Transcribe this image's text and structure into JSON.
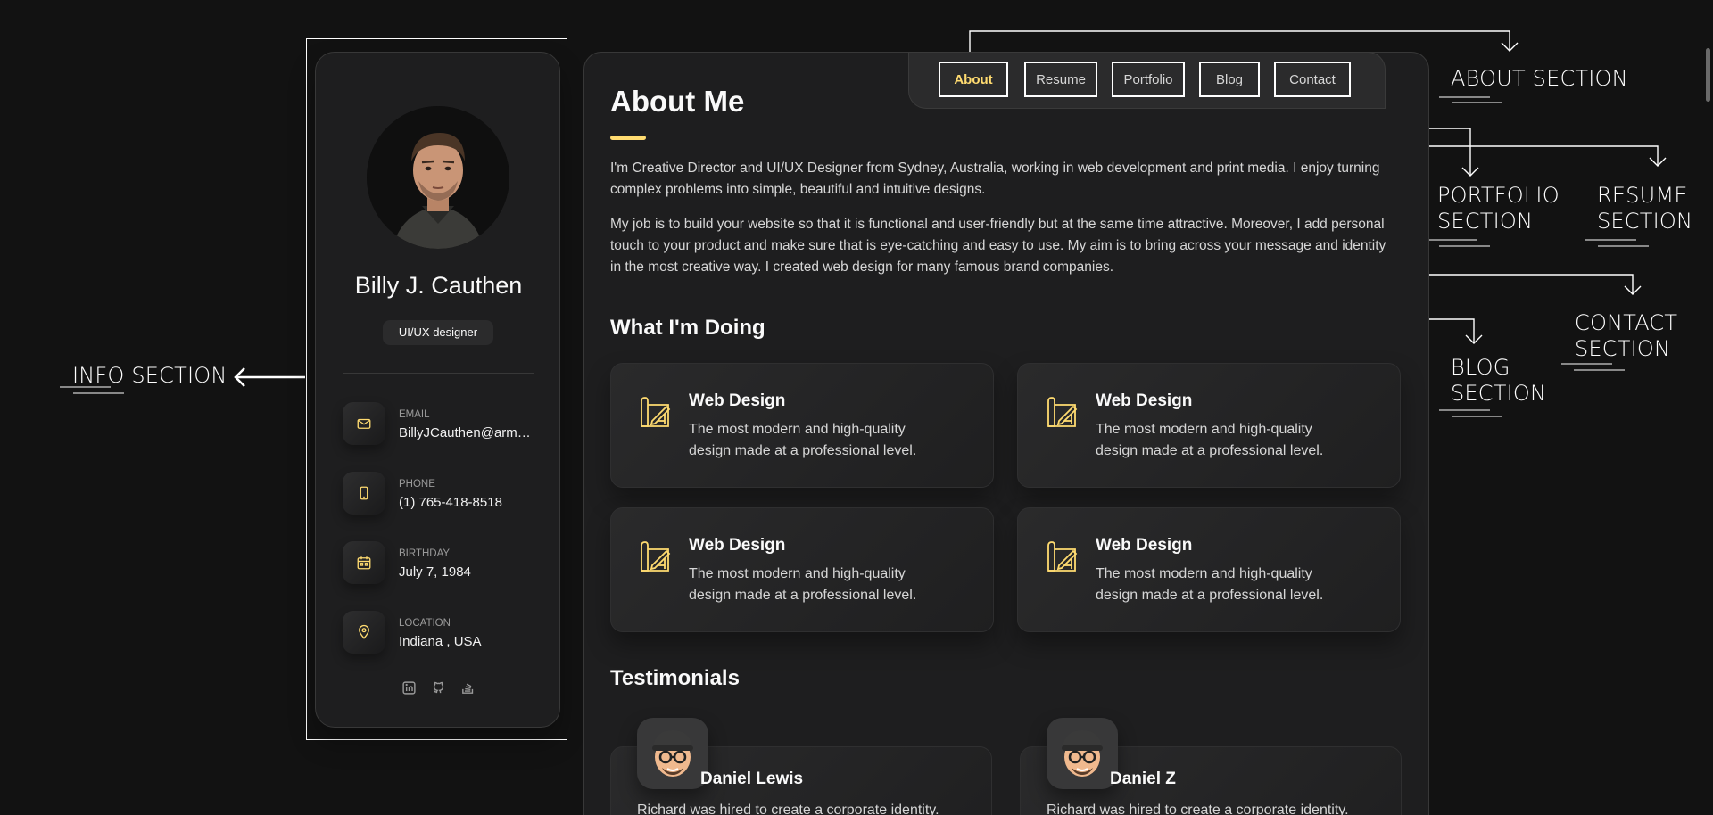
{
  "profile": {
    "name": "Billy J. Cauthen",
    "title": "UI/UX designer"
  },
  "contacts": [
    {
      "label": "EMAIL",
      "value": "BillyJCauthen@arm…",
      "icon": "mail-icon"
    },
    {
      "label": "PHONE",
      "value": "(1) 765-418-8518",
      "icon": "phone-icon"
    },
    {
      "label": "BIRTHDAY",
      "value": "July 7, 1984",
      "icon": "calendar-icon"
    },
    {
      "label": "LOCATION",
      "value": "Indiana , USA",
      "icon": "location-pin-icon"
    }
  ],
  "socials": [
    "linkedin-icon",
    "github-icon",
    "stackoverflow-icon"
  ],
  "nav": {
    "items": [
      "About",
      "Resume",
      "Portfolio",
      "Blog",
      "Contact"
    ],
    "active": "About"
  },
  "about": {
    "title": "About Me",
    "paragraph_1": "I'm Creative Director and UI/UX Designer from Sydney, Australia, working in web development and print media. I enjoy turning complex problems into simple, beautiful and intuitive designs.",
    "paragraph_2": "My job is to build your website so that it is functional and user-friendly but at the same time attractive. Moreover, I add personal touch to your product and make sure that is eye-catching and easy to use. My aim is to bring across your message and identity in the most creative way. I created web design for many famous brand companies."
  },
  "services": {
    "title": "What I'm Doing",
    "items": [
      {
        "title": "Web Design",
        "desc": "The most modern and high-quality design made at a professional level."
      },
      {
        "title": "Web Design",
        "desc": "The most modern and high-quality design made at a professional level."
      },
      {
        "title": "Web Design",
        "desc": "The most modern and high-quality design made at a professional level."
      },
      {
        "title": "Web Design",
        "desc": "The most modern and high-quality design made at a professional level."
      }
    ]
  },
  "testimonials": {
    "title": "Testimonials",
    "items": [
      {
        "name": "Daniel Lewis",
        "text": "Richard was hired to create a corporate identity."
      },
      {
        "name": "Daniel Z",
        "text": "Richard was hired to create a corporate identity."
      }
    ]
  },
  "annotations": {
    "info": "INFO SECTION",
    "about": "ABOUT SECTION",
    "portfolio": [
      "PORTFOLIO",
      "SECTION"
    ],
    "resume": [
      "RESUME",
      "SECTION"
    ],
    "contact": [
      "CONTACT",
      "SECTION"
    ],
    "blog": [
      "BLOG",
      "SECTION"
    ]
  },
  "colors": {
    "background": "#121212",
    "card": "#1e1e1f",
    "accent": "#ffdb70",
    "annotation": "#ffffff"
  }
}
